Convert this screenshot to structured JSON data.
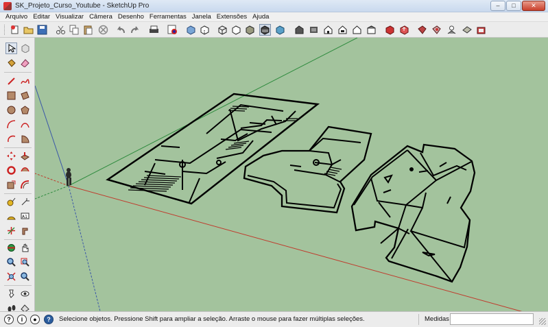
{
  "window": {
    "title": "SK_Projeto_Curso_Youtube - SketchUp Pro",
    "buttons": {
      "minimize": "–",
      "maximize": "□",
      "close": "✕"
    }
  },
  "menu": [
    "Arquivo",
    "Editar",
    "Visualizar",
    "Câmera",
    "Desenho",
    "Ferramentas",
    "Janela",
    "Extensões",
    "Ajuda"
  ],
  "toolbar": {
    "icons": [
      "new-icon",
      "open-icon",
      "save-icon",
      "cut-icon",
      "copy-icon",
      "paste-icon",
      "erase-icon",
      "undo-icon",
      "redo-icon",
      "print-icon",
      "model-info-icon",
      "xray-icon",
      "back-edges-icon",
      "wireframe-icon",
      "hidden-line-icon",
      "shaded-icon",
      "shaded-textures-icon",
      "monochrome-icon",
      "iso-icon",
      "top-icon",
      "front-icon",
      "right-icon",
      "back-icon",
      "left-icon",
      "get-models-icon",
      "share-model-icon",
      "share-component-icon",
      "extension-warehouse-icon",
      "layout-icon",
      "style-builder-icon"
    ],
    "active": "shaded-textures-icon"
  },
  "palette": {
    "tools": [
      "select-icon",
      "component-icon",
      "paint-bucket-icon",
      "eraser-icon",
      "line-icon",
      "freehand-icon",
      "rectangle-icon",
      "rotated-rectangle-icon",
      "circle-icon",
      "polygon-icon",
      "arc-icon",
      "two-point-arc-icon",
      "three-point-arc-icon",
      "pie-icon",
      "move-icon",
      "push-pull-icon",
      "rotate-icon",
      "follow-me-icon",
      "scale-icon",
      "offset-icon",
      "tape-measure-icon",
      "text-icon",
      "protractor-icon",
      "axes-icon",
      "dimension-icon",
      "3d-text-icon",
      "orbit-icon",
      "pan-icon",
      "zoom-icon",
      "zoom-window-icon",
      "zoom-extents-icon",
      "previous-view-icon",
      "position-camera-icon",
      "look-around-icon",
      "walk-icon",
      "section-plane-icon"
    ],
    "active": "select-icon"
  },
  "viewport": {
    "background": "#a3c39d",
    "axis_colors": {
      "red": "#c0392b",
      "green": "#2e8b3e",
      "blue": "#3a57a8"
    }
  },
  "status": {
    "message": "Selecione objetos. Pressione Shift para ampliar a seleção. Arraste o mouse para fazer múltiplas seleções.",
    "measurements_label": "Medidas",
    "measurements_value": "",
    "icons": [
      "geo-location-icon",
      "credit-icon",
      "help-icon"
    ]
  }
}
